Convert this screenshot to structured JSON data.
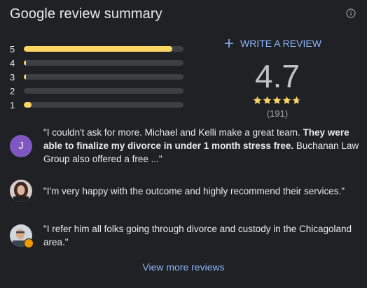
{
  "header": {
    "title": "Google review summary",
    "info_icon": "info-icon"
  },
  "distribution": [
    {
      "label": "5",
      "fraction": 0.93
    },
    {
      "label": "4",
      "fraction": 0.01
    },
    {
      "label": "3",
      "fraction": 0.01
    },
    {
      "label": "2",
      "fraction": 0.0
    },
    {
      "label": "1",
      "fraction": 0.05
    }
  ],
  "actions": {
    "write_review": "WRITE A REVIEW",
    "plus_icon": "plus-icon"
  },
  "summary": {
    "rating": "4.7",
    "rating_value": 4.7,
    "count": "(191)"
  },
  "reviews": [
    {
      "avatar_letter": "J",
      "avatar_color": "#7e57c2",
      "text_before": "\"I couldn't ask for more. Michael and Kelli make a great team. ",
      "text_bold": "They were able to finalize my divorce in under 1 month stress free.",
      "text_after": " Buchanan Law Group also offered a free ...\""
    },
    {
      "avatar_icon": "person-photo",
      "text": "\"I'm very happy with the outcome and highly recommend their services.\""
    },
    {
      "avatar_icon": "person-photo",
      "text": "\"I refer him all folks going through divorce and custody in the Chicagoland area.\""
    }
  ],
  "footer": {
    "view_more": "View more reviews"
  },
  "colors": {
    "accent": "#8ab4f8",
    "star": "#fdd663",
    "background": "#202124"
  }
}
